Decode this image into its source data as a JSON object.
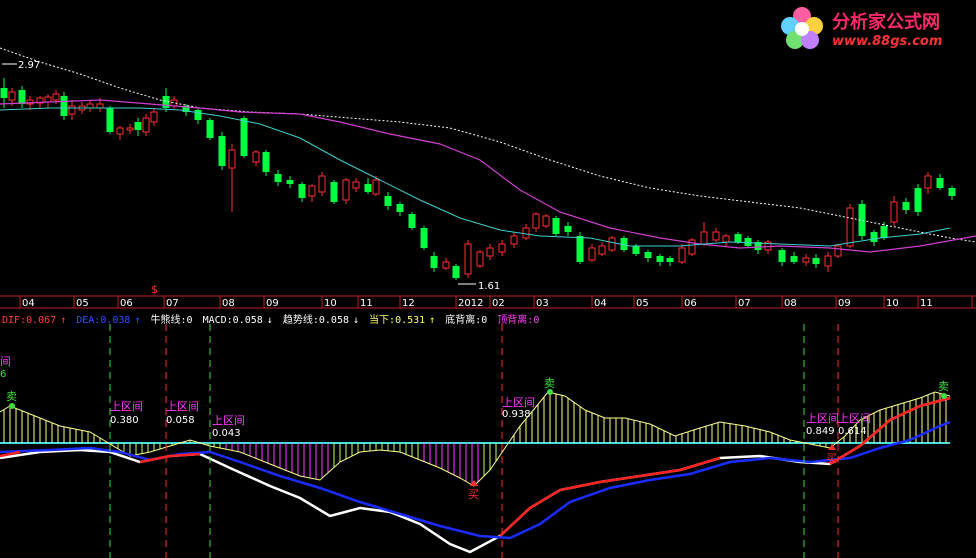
{
  "logo": {
    "title": "分析家公式网",
    "url": "www.88gs.com"
  },
  "price_panel": {
    "high_label": "2.97",
    "low_label": "1.61",
    "signal_mark": "$",
    "months": [
      "04",
      "05",
      "06",
      "07",
      "08",
      "09",
      "10",
      "11",
      "12",
      "2012",
      "02",
      "03",
      "04",
      "05",
      "06",
      "07",
      "08",
      "09",
      "10",
      "11",
      ""
    ]
  },
  "legend": {
    "dif": "DIF:0.067",
    "dea": "DEA:0.038",
    "bull": "牛熊线:0",
    "macd": "MACD:0.058",
    "trend": "趋势线:0.058",
    "current": "当下:0.531",
    "bottom_div": "底背离:0",
    "top_div": "顶背离:0"
  },
  "macd_panel": {
    "left_cut_label": "间",
    "left_cut_value": "6",
    "sell_label": "卖",
    "buy_label": "买",
    "zones": [
      {
        "label": "上区间",
        "value": "0.380"
      },
      {
        "label": "上区间",
        "value": "0.058"
      },
      {
        "label": "上区间",
        "value": "0.043"
      },
      {
        "label": "上区间",
        "value": "0.938"
      },
      {
        "label": "上区间",
        "value": "0.849"
      },
      {
        "label": "上区间",
        "value": "0.614"
      }
    ]
  },
  "colors": {
    "up": "#ff3030",
    "down": "#00ff40",
    "ma_long": "#ffffff",
    "ma_mid": "#d040d0",
    "ma_short": "#40d0d0",
    "dif": "#ffffff",
    "dea": "#1a2cff",
    "axis": "#c02020",
    "zero": "#40e0e0",
    "hist_pos": "#ffff80",
    "hist_neg_a": "#ff40ff",
    "hist_neg_b": "#c0ff60"
  },
  "chart_data": {
    "type": "candlestick+macd",
    "title": "",
    "price_axis_labels": {
      "max": 2.97,
      "min": 1.61
    },
    "macd": {
      "DIF": 0.067,
      "DEA": 0.038,
      "MACD": 0.058,
      "trend": 0.058,
      "current": 0.531
    }
  }
}
